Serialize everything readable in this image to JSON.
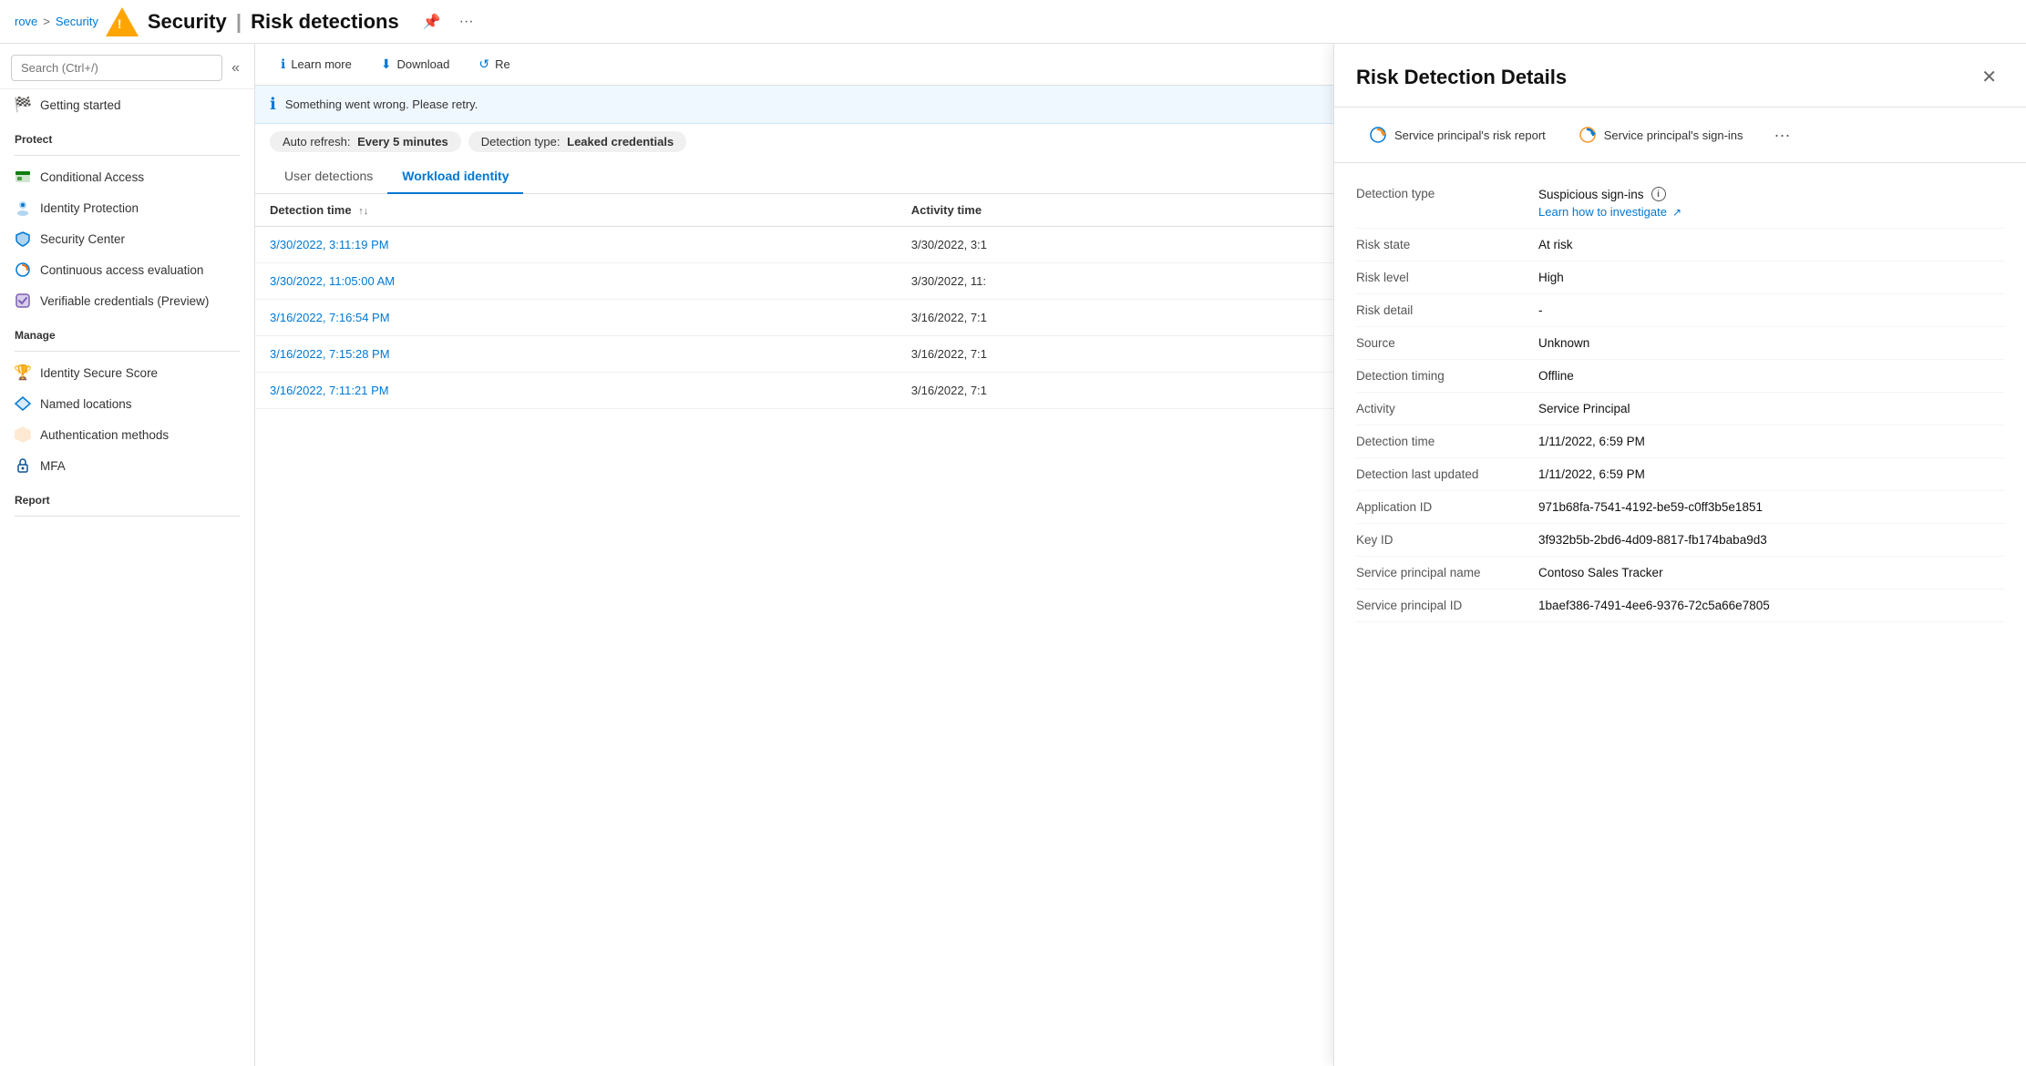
{
  "breadcrumb": {
    "items": [
      "rove",
      "Security"
    ],
    "separator": ">"
  },
  "header": {
    "title": "Security",
    "subtitle": "Risk detections",
    "warning_icon": "⚠",
    "pin_icon": "📌",
    "more_icon": "..."
  },
  "search": {
    "placeholder": "Search (Ctrl+/)"
  },
  "sidebar": {
    "collapse_icon": "«",
    "items_getting_started": [
      {
        "id": "getting-started",
        "label": "Getting started",
        "icon": "🏁"
      }
    ],
    "section_protect": "Protect",
    "items_protect": [
      {
        "id": "conditional-access",
        "label": "Conditional Access",
        "icon": "🟩"
      },
      {
        "id": "identity-protection",
        "label": "Identity Protection",
        "icon": "👤"
      },
      {
        "id": "security-center",
        "label": "Security Center",
        "icon": "🛡"
      },
      {
        "id": "continuous-access",
        "label": "Continuous access evaluation",
        "icon": "🔵"
      },
      {
        "id": "verifiable-credentials",
        "label": "Verifiable credentials (Preview)",
        "icon": "🟪"
      }
    ],
    "section_manage": "Manage",
    "items_manage": [
      {
        "id": "identity-secure-score",
        "label": "Identity Secure Score",
        "icon": "🏆"
      },
      {
        "id": "named-locations",
        "label": "Named locations",
        "icon": "🔷"
      },
      {
        "id": "auth-methods",
        "label": "Authentication methods",
        "icon": "🔶"
      },
      {
        "id": "mfa",
        "label": "MFA",
        "icon": "🔒"
      }
    ],
    "section_report": "Report"
  },
  "toolbar": {
    "learn_more": "Learn more",
    "download": "Download",
    "refresh": "Re",
    "learn_icon": "ℹ",
    "download_icon": "⬇",
    "refresh_icon": "↺"
  },
  "info_banner": {
    "message": "Something went wrong. Please retry.",
    "icon": "ℹ"
  },
  "filters": [
    {
      "label": "Auto refresh",
      "value": "Every 5 minutes"
    },
    {
      "label": "Detection type",
      "value": "Leaked credentials"
    }
  ],
  "tabs": [
    {
      "id": "user-detections",
      "label": "User detections",
      "active": false
    },
    {
      "id": "workload-identity",
      "label": "Workload identity",
      "active": true
    }
  ],
  "table": {
    "columns": [
      {
        "id": "detection-time",
        "label": "Detection time",
        "sortable": true
      },
      {
        "id": "activity-time",
        "label": "Activity time"
      }
    ],
    "rows": [
      {
        "id": "row1",
        "detection_time": "3/30/2022, 3:11:19 PM",
        "activity_time": "3/30/2022, 3:1"
      },
      {
        "id": "row2",
        "detection_time": "3/30/2022, 11:05:00 AM",
        "activity_time": "3/30/2022, 11:"
      },
      {
        "id": "row3",
        "detection_time": "3/16/2022, 7:16:54 PM",
        "activity_time": "3/16/2022, 7:1"
      },
      {
        "id": "row4",
        "detection_time": "3/16/2022, 7:15:28 PM",
        "activity_time": "3/16/2022, 7:1"
      },
      {
        "id": "row5",
        "detection_time": "3/16/2022, 7:11:21 PM",
        "activity_time": "3/16/2022, 7:1"
      }
    ]
  },
  "right_panel": {
    "title": "Risk Detection Details",
    "close_icon": "✕",
    "actions": [
      {
        "id": "service-principal-risk",
        "label": "Service principal's risk report",
        "icon_type": "cycle-blue"
      },
      {
        "id": "service-principal-signins",
        "label": "Service principal's sign-ins",
        "icon_type": "cycle-orange"
      }
    ],
    "more_dots": "···",
    "details": [
      {
        "label": "Detection type",
        "value": "Suspicious sign-ins",
        "has_info": true,
        "sub_link": "Learn how to investigate",
        "sub_link_external": true
      },
      {
        "label": "Risk state",
        "value": "At risk"
      },
      {
        "label": "Risk level",
        "value": "High"
      },
      {
        "label": "Risk detail",
        "value": "-"
      },
      {
        "label": "Source",
        "value": "Unknown"
      },
      {
        "label": "Detection timing",
        "value": "Offline"
      },
      {
        "label": "Activity",
        "value": "Service Principal"
      },
      {
        "label": "Detection time",
        "value": "1/11/2022, 6:59 PM"
      },
      {
        "label": "Detection last updated",
        "value": "1/11/2022, 6:59 PM"
      },
      {
        "label": "Application ID",
        "value": "971b68fa-7541-4192-be59-c0ff3b5e1851"
      },
      {
        "label": "Key ID",
        "value": "3f932b5b-2bd6-4d09-8817-fb174baba9d3"
      },
      {
        "label": "Service principal name",
        "value": "Contoso Sales Tracker"
      },
      {
        "label": "Service principal ID",
        "value": "1baef386-7491-4ee6-9376-72c5a66e7805"
      }
    ]
  }
}
